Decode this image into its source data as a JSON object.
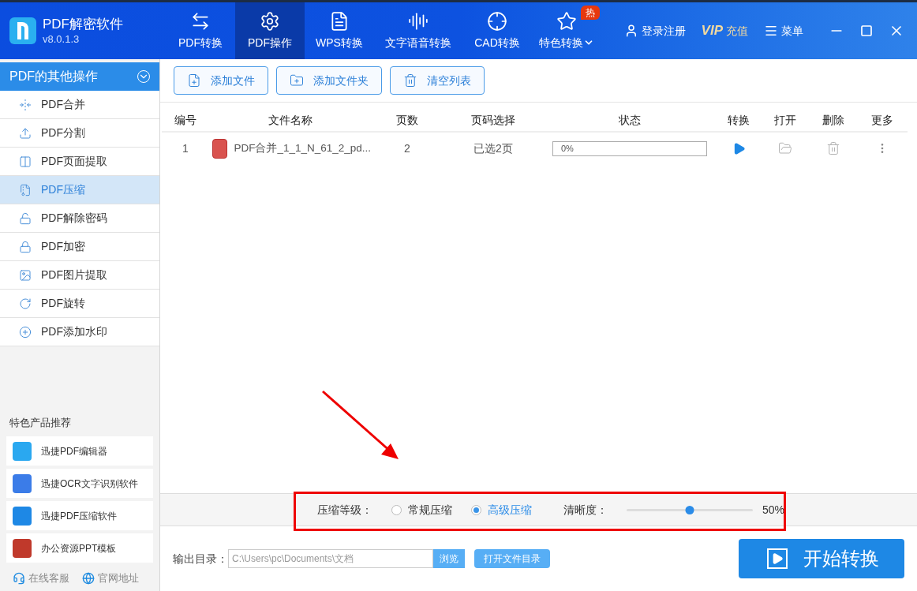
{
  "app": {
    "title": "PDF解密软件",
    "version": "v8.0.1.3"
  },
  "nav": [
    {
      "label": "PDF转换",
      "selected": false
    },
    {
      "label": "PDF操作",
      "selected": true
    },
    {
      "label": "WPS转换",
      "selected": false
    },
    {
      "label": "文字语音转换",
      "selected": false
    },
    {
      "label": "CAD转换",
      "selected": false
    },
    {
      "label": "特色转换",
      "selected": false,
      "badge": "热"
    }
  ],
  "header_actions": {
    "login": "登录注册",
    "vip_logo": "VIP",
    "recharge": "充值",
    "menu": "菜单"
  },
  "sidebar": {
    "title": "PDF的其他操作",
    "items": [
      {
        "label": "PDF合并",
        "selected": false
      },
      {
        "label": "PDF分割",
        "selected": false
      },
      {
        "label": "PDF页面提取",
        "selected": false
      },
      {
        "label": "PDF压缩",
        "selected": true
      },
      {
        "label": "PDF解除密码",
        "selected": false
      },
      {
        "label": "PDF加密",
        "selected": false
      },
      {
        "label": "PDF图片提取",
        "selected": false
      },
      {
        "label": "PDF旋转",
        "selected": false
      },
      {
        "label": "PDF添加水印",
        "selected": false
      }
    ]
  },
  "featured": {
    "title": "特色产品推荐",
    "items": [
      "迅捷PDF编辑器",
      "迅捷OCR文字识别软件",
      "迅捷PDF压缩软件",
      "办公资源PPT模板"
    ]
  },
  "footer_links": [
    "在线客服",
    "官网地址"
  ],
  "toolbar": [
    "添加文件",
    "添加文件夹",
    "清空列表"
  ],
  "table": {
    "columns": [
      "编号",
      "文件名称",
      "页数",
      "页码选择",
      "状态",
      "转换",
      "打开",
      "删除",
      "更多"
    ],
    "rows": [
      {
        "index": "1",
        "name": "PDF合并_1_1_N_61_2_pd...",
        "pages": "2",
        "page_selection": "已选2页",
        "progress": "0%",
        "level": 0
      }
    ]
  },
  "compression": {
    "label": "压缩等级：",
    "options": [
      {
        "label": "常规压缩",
        "selected": false
      },
      {
        "label": "高级压缩",
        "selected": true
      }
    ],
    "clarity_label": "清晰度：",
    "level": 0.5,
    "reading": "50%"
  },
  "output": {
    "label": "输出目录：",
    "path": "C:\\Users\\pc\\Documents\\文档",
    "browse": "浏览",
    "open_folder": "打开文件目录"
  },
  "start_button": "开始转换"
}
